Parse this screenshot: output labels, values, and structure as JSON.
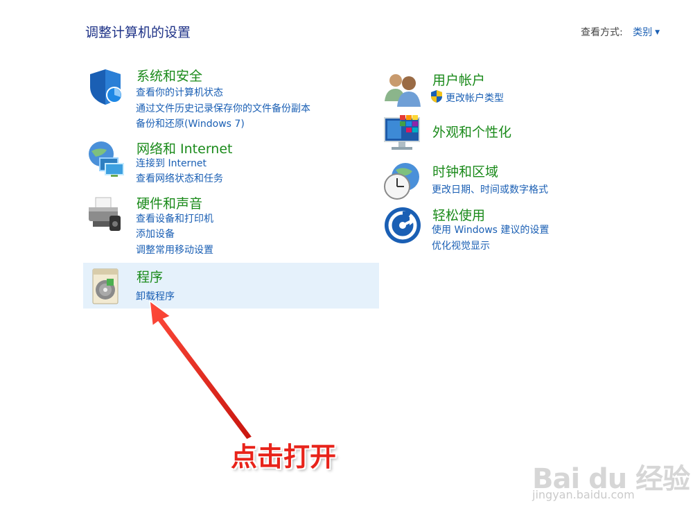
{
  "header": {
    "title": "调整计算机的设置",
    "view_by_label": "查看方式:",
    "view_by_value": "类别"
  },
  "categories": {
    "system_security": {
      "title": "系统和安全",
      "links": [
        "查看你的计算机状态",
        "通过文件历史记录保存你的文件备份副本",
        "备份和还原(Windows 7)"
      ]
    },
    "network": {
      "title": "网络和 Internet",
      "links": [
        "连接到 Internet",
        "查看网络状态和任务"
      ]
    },
    "hardware": {
      "title": "硬件和声音",
      "links": [
        "查看设备和打印机",
        "添加设备",
        "调整常用移动设置"
      ]
    },
    "programs": {
      "title": "程序",
      "links": [
        "卸载程序"
      ]
    },
    "user_accounts": {
      "title": "用户帐户",
      "links": [
        "更改帐户类型"
      ]
    },
    "appearance": {
      "title": "外观和个性化",
      "links": []
    },
    "clock_region": {
      "title": "时钟和区域",
      "links": [
        "更改日期、时间或数字格式"
      ]
    },
    "ease_of_access": {
      "title": "轻松使用",
      "links": [
        "使用 Windows 建议的设置",
        "优化视觉显示"
      ]
    }
  },
  "annotation": {
    "text": "点击打开",
    "color": "#e8231a"
  },
  "watermark": {
    "brand": "Bai du 经验",
    "url": "jingyan.baidu.com"
  },
  "colors": {
    "category_title": "#1a8a1a",
    "link": "#1a5fb4",
    "header_title": "#1e3287",
    "selected_bg": "#e5f1fb"
  }
}
